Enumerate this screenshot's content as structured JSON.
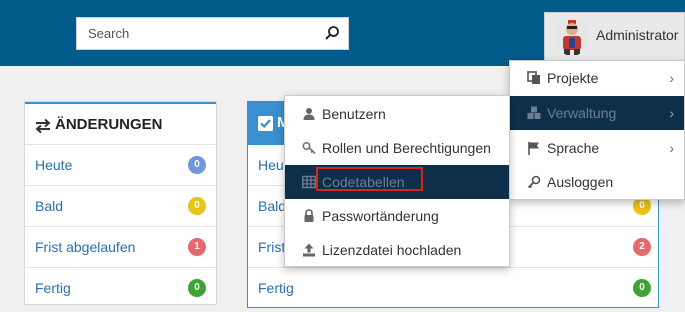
{
  "header": {
    "search": {
      "placeholder": "Search"
    },
    "user": {
      "name": "Administrator"
    },
    "colors": {
      "bar": "#005b8a"
    }
  },
  "panel_changes": {
    "title": "ÄNDERUNGEN",
    "rows": [
      {
        "label": "Heute",
        "count": "0",
        "color": "#6f97d9"
      },
      {
        "label": "Bald",
        "count": "0",
        "color": "#e9c31a"
      },
      {
        "label": "Frist abgelaufen",
        "count": "1",
        "color": "#e56a6e"
      },
      {
        "label": "Fertig",
        "count": "0",
        "color": "#3da335"
      }
    ]
  },
  "panel_second": {
    "title": "M",
    "rows": [
      {
        "label": "Heute",
        "count": "",
        "color": ""
      },
      {
        "label": "Bald",
        "count": "0",
        "color": "#e9c31a"
      },
      {
        "label": "Frist abgelaufen",
        "count": "2",
        "color": "#e56a6e"
      },
      {
        "label": "Fertig",
        "count": "0",
        "color": "#3da335"
      }
    ]
  },
  "user_menu": {
    "items": [
      {
        "label": "Projekte",
        "icon": "copy-icon",
        "submenu": true
      },
      {
        "label": "Verwaltung",
        "icon": "cubes-icon",
        "submenu": true,
        "active": true
      },
      {
        "label": "Sprache",
        "icon": "flag-icon",
        "submenu": true
      },
      {
        "label": "Ausloggen",
        "icon": "key-icon",
        "submenu": false
      }
    ],
    "chevron": "›"
  },
  "admin_submenu": {
    "items": [
      {
        "label": "Benutzern",
        "icon": "user-icon"
      },
      {
        "label": "Rollen und Berechtigungen",
        "icon": "key-icon"
      },
      {
        "label": "Codetabellen",
        "icon": "table-icon",
        "active": true
      },
      {
        "label": "Passwortänderung",
        "icon": "lock-icon"
      },
      {
        "label": "Lizenzdatei hochladen",
        "icon": "upload-icon"
      }
    ]
  }
}
